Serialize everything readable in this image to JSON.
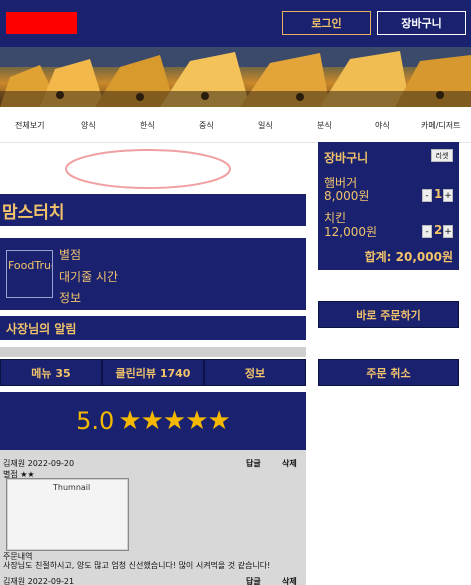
{
  "header": {
    "logo_color": "#ff0000",
    "login_label": "로그인",
    "cart_label": "장바구니"
  },
  "categories": [
    "전체보기",
    "양식",
    "한식",
    "중식",
    "일식",
    "분식",
    "야식",
    "카페/디저트"
  ],
  "store": {
    "name": "맘스터치",
    "image_alt": "FoodTruck",
    "info_lines": [
      "별점",
      "대기줄 시간",
      "정보"
    ],
    "notice_label": "사장님의 알림"
  },
  "tabs": [
    "메뉴 35",
    "클린리뷰 1740",
    "정보"
  ],
  "rating": {
    "score": "5.0",
    "stars": "★★★★★",
    "star_count": 5
  },
  "reviews": [
    {
      "header": "김재원 2022-09-20",
      "reply_label": "답글",
      "delete_label": "삭제",
      "rating_line": "별점 ★★",
      "thumbnail_alt": "Thumnail",
      "order_label": "주문내역",
      "text": "사장님도 친절하시고, 양도 많고 엄청 신선했습니다! 많이 시켜먹을 것 같습니다!"
    },
    {
      "header": "김재원 2022-09-21",
      "reply_label": "답글",
      "delete_label": "삭제"
    }
  ],
  "cart": {
    "title": "장바구니",
    "reset_label": "리셋",
    "items": [
      {
        "name": "햄버거",
        "price": "8,000원",
        "qty": "1",
        "minus": "-",
        "plus": "+"
      },
      {
        "name": "치킨",
        "price": "12,000원",
        "qty": "2",
        "minus": "-",
        "plus": "+"
      }
    ],
    "total": "합계: 20,000원"
  },
  "actions": {
    "order_label": "바로 주문하기",
    "cancel_label": "주문 취소"
  },
  "colors": {
    "navy": "#1a2270",
    "gold_text": "#f2c36b",
    "star": "#f5b800",
    "oval_stroke": "#f0a0a0"
  }
}
